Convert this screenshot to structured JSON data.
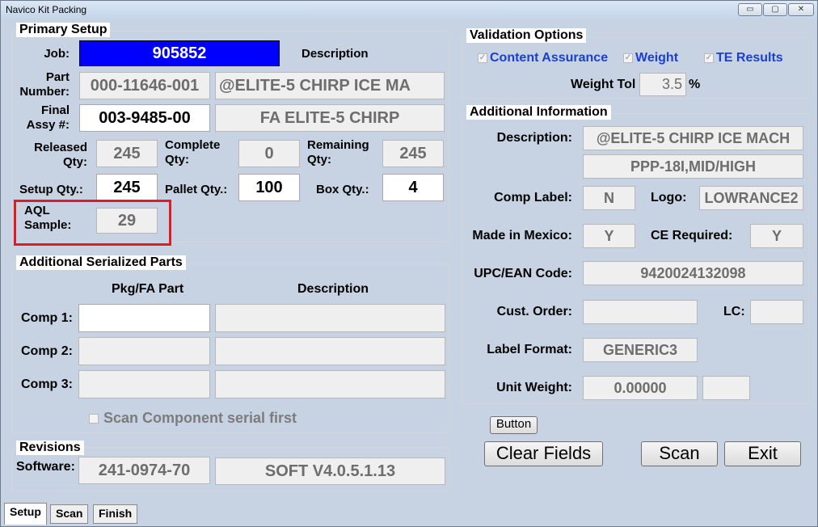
{
  "window": {
    "title": "Navico Kit Packing",
    "min_label": "▭",
    "max_label": "▢",
    "close_label": "✕"
  },
  "primary_setup": {
    "title": "Primary Setup",
    "job_label": "Job:",
    "job_value": "905852",
    "description_label": "Description",
    "part_number_label": "Part\nNumber:",
    "part_number_value": "000-11646-001",
    "part_description": "@ELITE-5 CHIRP ICE MA",
    "final_assy_label": "Final\nAssy #:",
    "final_assy_value": "003-9485-00",
    "final_assy_description": "FA ELITE-5 CHIRP",
    "released_qty_label": "Released\nQty:",
    "released_qty_value": "245",
    "complete_qty_label": "Complete\nQty:",
    "complete_qty_value": "0",
    "remaining_label": "Remaining\nQty:",
    "remaining_value": "245",
    "setup_qty_label": "Setup Qty.:",
    "setup_qty_value": "245",
    "pallet_qty_label": "Pallet Qty.:",
    "pallet_qty_value": "100",
    "box_qty_label": "Box Qty.:",
    "box_qty_value": "4",
    "aql_label": "AQL\nSample:",
    "aql_value": "29"
  },
  "additional_parts": {
    "title": "Additional Serialized Parts",
    "col_pkg": "Pkg/FA Part",
    "col_desc": "Description",
    "comp1_label": "Comp 1:",
    "comp2_label": "Comp 2:",
    "comp3_label": "Comp 3:",
    "scan_checkbox_label": "Scan Component  serial first"
  },
  "revisions": {
    "title": "Revisions",
    "software_label": "Software:",
    "software_value": "241-0974-70",
    "software_description": "SOFT V4.0.5.1.13"
  },
  "validation": {
    "title": "Validation Options",
    "content_assurance": "Content Assurance",
    "weight": "Weight",
    "te_results": "TE Results",
    "weight_tol_label": "Weight Tol",
    "weight_tol_value": "3.5",
    "weight_tol_unit": "%"
  },
  "additional_info": {
    "title": "Additional Information",
    "description_label": "Description:",
    "description_value": "@ELITE-5 CHIRP ICE MACH",
    "description_value2": "PPP-18I,MID/HIGH",
    "comp_label_label": "Comp Label:",
    "comp_label_value": "N",
    "logo_label": "Logo:",
    "logo_value": "LOWRANCE2",
    "made_in_mexico_label": "Made in Mexico:",
    "made_in_mexico_value": "Y",
    "ce_required_label": "CE Required:",
    "ce_required_value": "Y",
    "upc_label": "UPC/EAN Code:",
    "upc_value": "9420024132098",
    "cust_order_label": "Cust. Order:",
    "cust_order_value": "",
    "lc_label": "LC:",
    "lc_value": "",
    "label_format_label": "Label Format:",
    "label_format_value": "GENERIC3",
    "unit_weight_label": "Unit Weight:",
    "unit_weight_value": "0.00000",
    "unit_weight_extra": ""
  },
  "buttons": {
    "button_label": "Button",
    "clear_fields": "Clear Fields",
    "scan": "Scan",
    "exit": "Exit"
  },
  "tabs": [
    "Setup",
    "Scan",
    "Finish"
  ],
  "colors": {
    "job_highlight": "#0000ff",
    "aql_box": "#e01b24",
    "checkbox_text": "#1a3fd2"
  }
}
